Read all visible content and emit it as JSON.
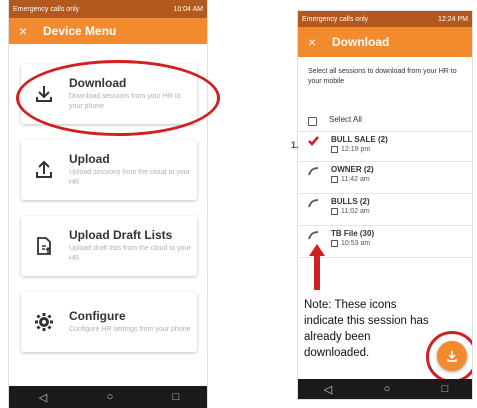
{
  "left": {
    "status": {
      "left": "Emergency calls only",
      "right": "10:04 AM"
    },
    "appbar": {
      "close": "×",
      "title": "Device Menu"
    },
    "items": [
      {
        "title": "Download",
        "desc": "Download sessions from your HR to your phone",
        "icon": "download-icon"
      },
      {
        "title": "Upload",
        "desc": "Upload sessions from the cloud to your HR",
        "icon": "upload-icon"
      },
      {
        "title": "Upload Draft Lists",
        "desc": "Upload draft lists from the cloud to your HR",
        "icon": "file-upload-icon"
      },
      {
        "title": "Configure",
        "desc": "Configure HR settings from your phone",
        "icon": "gear-icon"
      }
    ],
    "nav": {
      "back": "◁",
      "home": "○",
      "recent": "□"
    }
  },
  "right": {
    "status": {
      "left": "Emergency calls only",
      "right": "12:24 PM"
    },
    "appbar": {
      "close": "×",
      "title": "Download"
    },
    "instructions": "Select all sessions to download from your HR to your mobile",
    "select_all": "Select All",
    "sessions": [
      {
        "name": "BULL SALE (2)",
        "time": "12:19 pm",
        "state": "checked"
      },
      {
        "name": "OWNER (2)",
        "time": "11:42 am",
        "state": "downloaded"
      },
      {
        "name": "BULLS (2)",
        "time": "11:02 am",
        "state": "downloaded"
      },
      {
        "name": "TB File (30)",
        "time": "10:53 am",
        "state": "downloaded"
      }
    ],
    "nav": {
      "back": "◁",
      "home": "○",
      "recent": "□"
    }
  },
  "annotations": {
    "number_label": "1.",
    "note": "Note: These icons indicate this session has already been downloaded.",
    "accent": "#d02020"
  },
  "colors": {
    "orange": "#f28a2e",
    "status_bar": "#b3591e"
  }
}
